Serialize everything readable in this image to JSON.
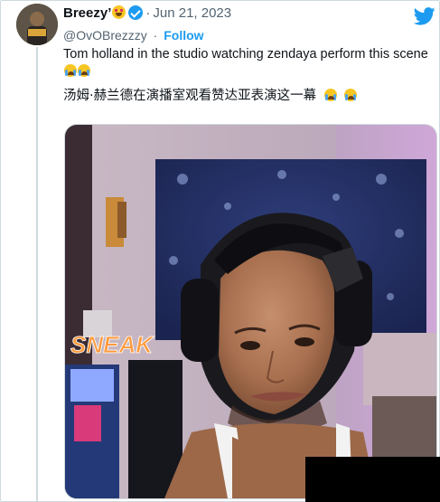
{
  "tweet": {
    "display_name": "Breezy’",
    "name_emoji": "smiling-face-with-heart-eyes-emoji",
    "date": "Jun 21, 2023",
    "handle": "@OvOBrezzzy",
    "follow_label": "Follow",
    "separator": "·",
    "text_line_1": "Tom holland in the studio watching zendaya perform this scene",
    "text_line_2": "汤姆·赫兰德在演播室观看赞达亚表演这一幕",
    "text_emojis": [
      "loudly-crying-face-emoji",
      "loudly-crying-face-emoji"
    ]
  },
  "media": {
    "overlay_text": "SNEAK"
  },
  "colors": {
    "twitter_blue": "#1d9bf0",
    "text_primary": "#0f1419",
    "text_secondary": "#536471",
    "border": "#cfd9de"
  }
}
